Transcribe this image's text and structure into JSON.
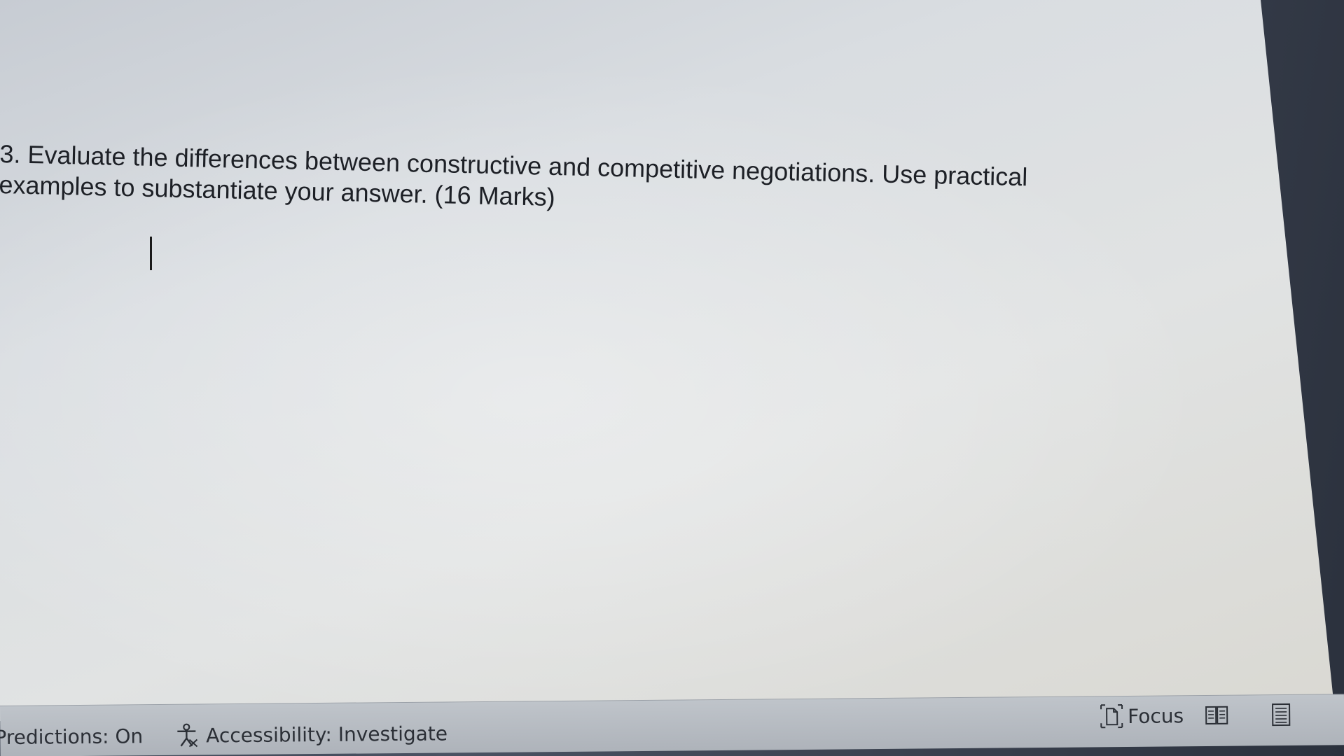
{
  "document": {
    "question_line1": "3. Evaluate the differences between constructive and competitive negotiations. Use practical",
    "question_line2": "examples to substantiate your answer. (16 Marks)"
  },
  "statusbar": {
    "predictions": "Predictions: On",
    "accessibility_label": "Accessibility: Investigate",
    "focus_label": "Focus",
    "icons": [
      "accessibility-icon",
      "focus-icon",
      "read-mode-icon",
      "print-layout-icon"
    ]
  },
  "colors": {
    "page": "#dcdfe2",
    "text": "#1d2026",
    "statusbar": "#b8bdc3"
  }
}
